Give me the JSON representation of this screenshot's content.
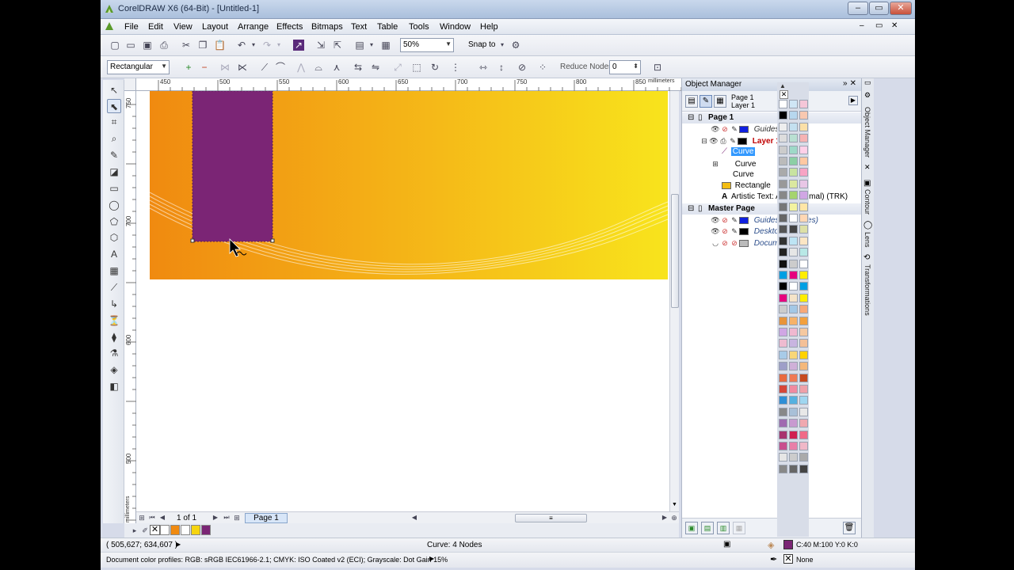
{
  "window": {
    "title": "CorelDRAW X6 (64-Bit) - [Untitled-1]",
    "controls": [
      "–",
      "▭",
      "✕"
    ]
  },
  "menu": [
    "File",
    "Edit",
    "View",
    "Layout",
    "Arrange",
    "Effects",
    "Bitmaps",
    "Text",
    "Table",
    "Tools",
    "Window",
    "Help"
  ],
  "standard_toolbar": {
    "zoom": "50%",
    "snap_to": "Snap to"
  },
  "property_bar": {
    "selection_mode": "Rectangular",
    "reduce_nodes_label": "Reduce Nodes",
    "reduce_nodes_value": "0"
  },
  "rulers": {
    "horizontal_labels": [
      "450",
      "500",
      "550",
      "600",
      "650",
      "700",
      "750",
      "800",
      "850"
    ],
    "unit": "millimeters",
    "vertical_labels": [
      "750",
      "700",
      "650",
      "600",
      "550",
      "500",
      "450"
    ]
  },
  "page_nav": {
    "count": "1 of 1",
    "tab": "Page 1"
  },
  "status": {
    "coords": "( 505,627; 634,607 )",
    "selection": "Curve: 4 Nodes",
    "fill": "C:40 M:100 Y:0 K:0",
    "outline": "None",
    "profiles": "Document color profiles: RGB: sRGB IEC61966-2.1; CMYK: ISO Coated v2 (ECI); Grayscale: Dot Gain 15%"
  },
  "object_manager": {
    "title": "Object Manager",
    "current_page": "Page 1",
    "current_layer": "Layer 1",
    "page": "Page 1",
    "guides": "Guides",
    "layer": "Layer 1",
    "objects": [
      "Curve",
      "Curve",
      "Curve",
      "Rectangle",
      "Artistic Text: Arial (Normal) (TRK)"
    ],
    "master_page": "Master Page",
    "master_guides": "Guides (all pages)",
    "desktop": "Desktop",
    "doc_grid": "Document Grid"
  },
  "docker_tabs": [
    "Object Manager",
    "Contour",
    "Lens",
    "Transformations"
  ],
  "colors": {
    "purple": "#7b2575",
    "orange_start": "#f08a10",
    "yellow_end": "#f8e21a",
    "layer_red": "#c00000"
  },
  "doc_palette": [
    "#ffffff",
    "#f08a10",
    "#ffffff",
    "#f6d40f",
    "#7b2575"
  ],
  "palette": [
    "#ffffff",
    "#cfe6f5",
    "#f5c6d8",
    "#000000",
    "#b7d7ee",
    "#f8c8b0",
    "#eeeeee",
    "#c4e0f0",
    "#fbe0a8",
    "#dddddd",
    "#b9e0d2",
    "#f6b3b3",
    "#cccccc",
    "#9ed9c8",
    "#ffd0e8",
    "#bbbbbb",
    "#8ccfa5",
    "#ffc8a2",
    "#aaaaaa",
    "#c8e3a0",
    "#f7a4c4",
    "#999999",
    "#dbe8a0",
    "#e8c6e6",
    "#888888",
    "#a5d46e",
    "#d0a6e4",
    "#777777",
    "#f3f3a0",
    "#ffe6a6",
    "#666666",
    "#ffffff",
    "#ffd7b4",
    "#555555",
    "#444444",
    "#dde0a6",
    "#333333",
    "#bde4f4",
    "#fce6c4",
    "#222222",
    "#e6e6e6",
    "#b8e8e6",
    "#111111",
    "#cccccc",
    "#ffffff",
    "#009fe3",
    "#e6007e",
    "#ffed00",
    "#000000",
    "#ffffff",
    "#009fe3",
    "#e6007e",
    "#f4e3c8",
    "#ffed00",
    "#cccccc",
    "#a3c8e6",
    "#f7a878",
    "#e8943a",
    "#f6b26a",
    "#f2a03e",
    "#d0a6e4",
    "#efb8d0",
    "#f5c8a0",
    "#eebbd0",
    "#c8b4e0",
    "#f4c098",
    "#a8cbe8",
    "#f8d678",
    "#ffd200",
    "#9e9ec8",
    "#cfb0d8",
    "#f4b87c",
    "#e86a3e",
    "#ef7a54",
    "#c64a20",
    "#d64638",
    "#f08aa0",
    "#efa0a8",
    "#2f8fd6",
    "#55b1e0",
    "#9fd6f0",
    "#888888",
    "#a8c0d8",
    "#e8e8e8",
    "#a06ab0",
    "#c89ad0",
    "#f0a8b0",
    "#a8326e",
    "#d02050",
    "#f06a88",
    "#c84e8e",
    "#e880a8",
    "#f0b8c8",
    "#e6e6e6",
    "#cccccc",
    "#aaaaaa",
    "#888888",
    "#666666",
    "#444444"
  ]
}
